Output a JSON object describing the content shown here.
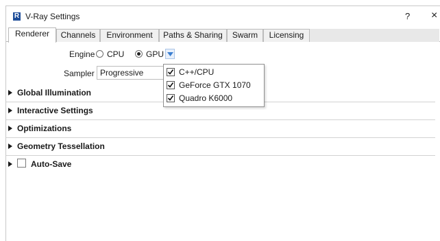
{
  "window": {
    "logo_letter": "R",
    "title": "V-Ray Settings",
    "help": "?",
    "close": "×"
  },
  "tabs": [
    {
      "label": "Renderer",
      "active": true
    },
    {
      "label": "Channels",
      "active": false
    },
    {
      "label": "Environment",
      "active": false
    },
    {
      "label": "Paths & Sharing",
      "active": false
    },
    {
      "label": "Swarm",
      "active": false
    },
    {
      "label": "Licensing",
      "active": false
    }
  ],
  "engine": {
    "label": "Engine",
    "options": [
      {
        "label": "CPU",
        "selected": false
      },
      {
        "label": "GPU",
        "selected": true
      }
    ]
  },
  "sampler": {
    "label": "Sampler",
    "value": "Progressive"
  },
  "device_popup": {
    "items": [
      {
        "label": "C++/CPU",
        "checked": true
      },
      {
        "label": "GeForce GTX 1070",
        "checked": true
      },
      {
        "label": "Quadro K6000",
        "checked": true
      }
    ]
  },
  "sections": [
    {
      "label": "Global Illumination"
    },
    {
      "label": "Interactive Settings"
    },
    {
      "label": "Optimizations"
    },
    {
      "label": "Geometry Tessellation"
    },
    {
      "label": "Auto-Save",
      "has_checkbox": true,
      "checked": false
    }
  ],
  "colors": {
    "logo": "#1f4e9a",
    "dropdown_arrow": "#3b7fd1"
  }
}
